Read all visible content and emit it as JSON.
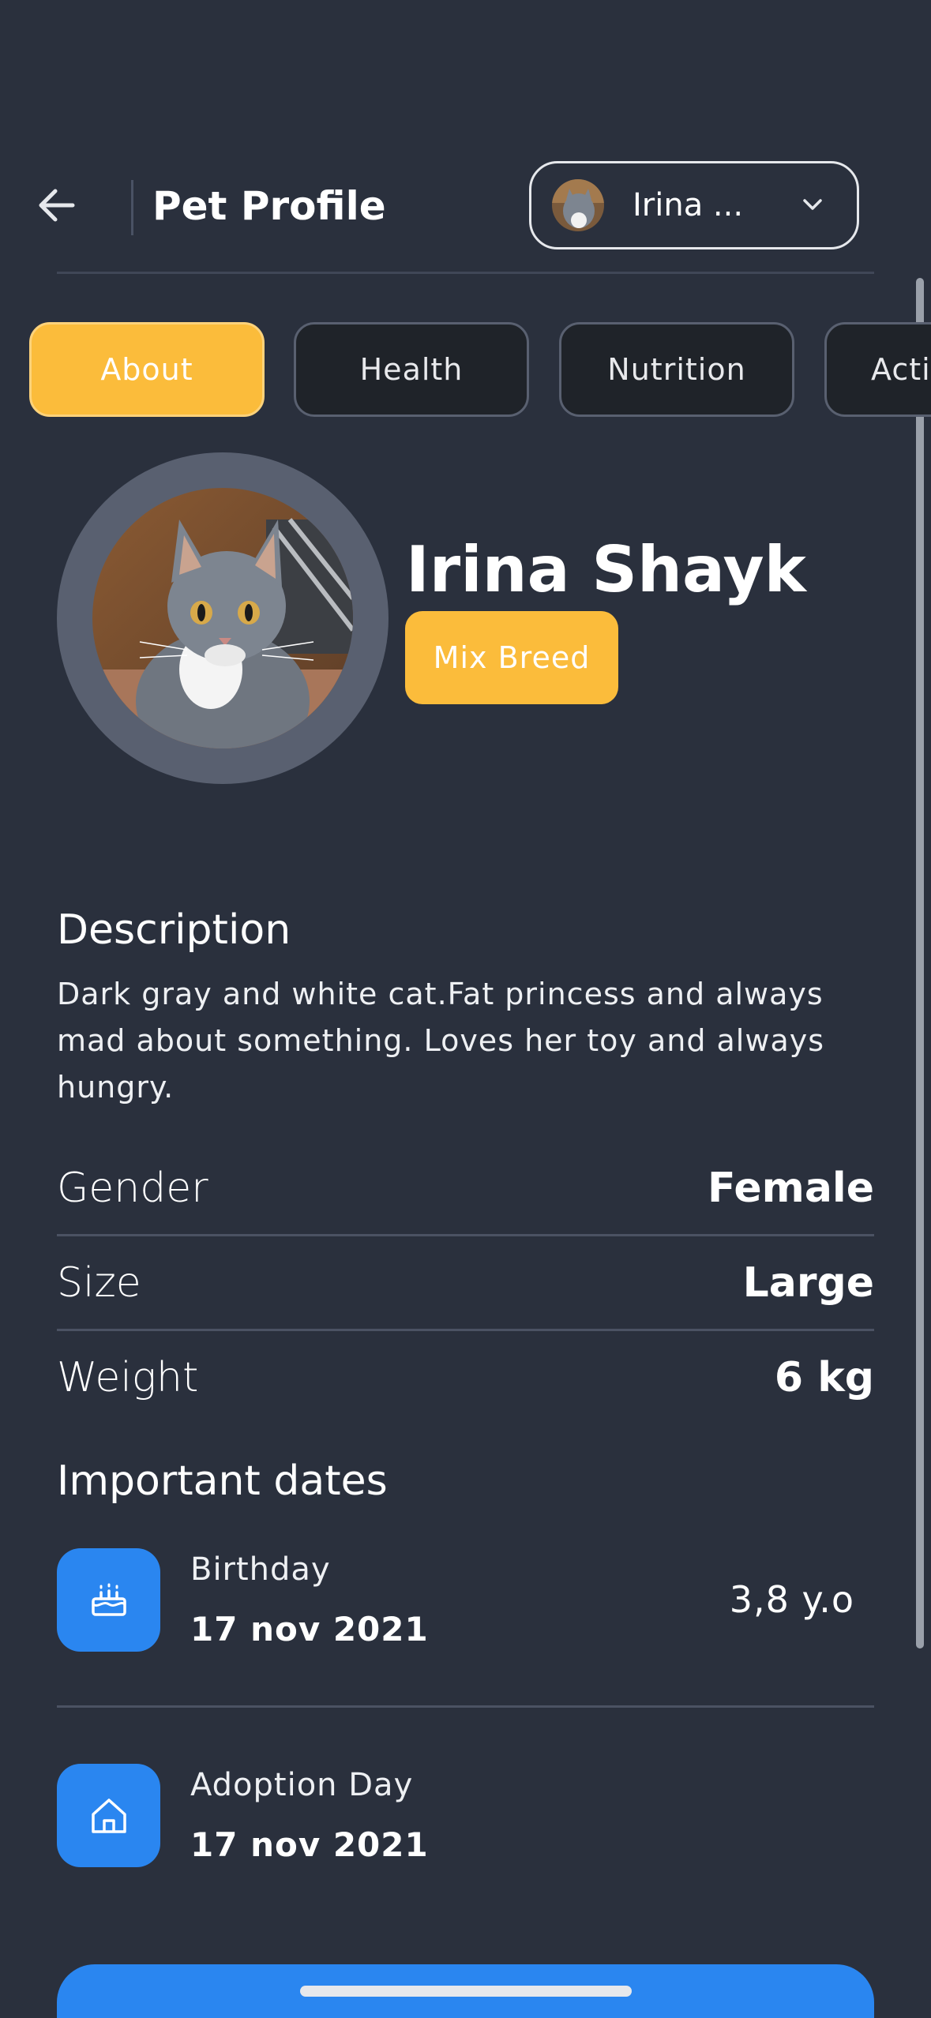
{
  "header": {
    "title": "Pet Profile",
    "selected_pet": "Irina ..."
  },
  "tabs": [
    {
      "label": "About",
      "active": true
    },
    {
      "label": "Health",
      "active": false
    },
    {
      "label": "Nutrition",
      "active": false
    },
    {
      "label": "Acti",
      "active": false
    }
  ],
  "profile": {
    "name": "Irina Shayk",
    "breed": "Mix Breed"
  },
  "description": {
    "title": "Description",
    "text": "Dark gray and white cat.Fat princess and always mad about something. Loves her toy and always hungry."
  },
  "attributes": [
    {
      "label": "Gender",
      "value": "Female"
    },
    {
      "label": "Size",
      "value": "Large"
    },
    {
      "label": "Weight",
      "value": "6 kg"
    }
  ],
  "important_dates": {
    "title": "Important dates",
    "items": [
      {
        "label": "Birthday",
        "date": "17 nov 2021",
        "extra": "3,8 y.o",
        "icon": "cake-icon"
      },
      {
        "label": "Adoption Day",
        "date": "17 nov 2021",
        "icon": "home-icon"
      }
    ]
  },
  "colors": {
    "background": "#2a303d",
    "accent_yellow": "#fbbc3b",
    "accent_blue": "#2a86f0"
  }
}
